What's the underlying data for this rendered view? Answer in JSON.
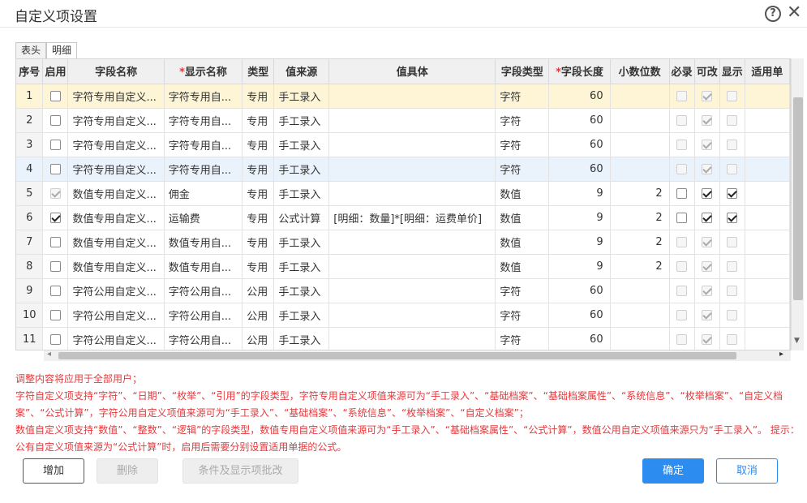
{
  "window": {
    "title": "自定义项设置"
  },
  "tabs": [
    {
      "label": "表头",
      "active": false
    },
    {
      "label": "明细",
      "active": true
    }
  ],
  "table": {
    "columns": [
      "序号",
      "启用",
      "字段名称",
      "显示名称",
      "类型",
      "值来源",
      "值具体",
      "字段类型",
      "字段长度",
      "小数位数",
      "必录",
      "可改",
      "显示",
      "适用单"
    ],
    "required_marks": {
      "显示名称": "*",
      "字段长度": "*"
    },
    "rows": [
      {
        "seq": "1",
        "enabled": false,
        "enabled_disabled": false,
        "field_name": "字符专用自定义...",
        "display_name": "字符专用自...",
        "type": "专用",
        "source": "手工录入",
        "value_detail": "",
        "field_type": "字符",
        "length": "60",
        "decimals": "",
        "required": false,
        "editable": true,
        "visible": false,
        "flags_disabled": true
      },
      {
        "seq": "2",
        "enabled": false,
        "enabled_disabled": false,
        "field_name": "字符专用自定义...",
        "display_name": "字符专用自...",
        "type": "专用",
        "source": "手工录入",
        "value_detail": "",
        "field_type": "字符",
        "length": "60",
        "decimals": "",
        "required": false,
        "editable": true,
        "visible": false,
        "flags_disabled": true
      },
      {
        "seq": "3",
        "enabled": false,
        "enabled_disabled": false,
        "field_name": "字符专用自定义...",
        "display_name": "字符专用自...",
        "type": "专用",
        "source": "手工录入",
        "value_detail": "",
        "field_type": "字符",
        "length": "60",
        "decimals": "",
        "required": false,
        "editable": true,
        "visible": false,
        "flags_disabled": true
      },
      {
        "seq": "4",
        "enabled": false,
        "enabled_disabled": false,
        "field_name": "字符专用自定义...",
        "display_name": "字符专用自...",
        "type": "专用",
        "source": "手工录入",
        "value_detail": "",
        "field_type": "字符",
        "length": "60",
        "decimals": "",
        "required": false,
        "editable": true,
        "visible": false,
        "flags_disabled": true
      },
      {
        "seq": "5",
        "enabled": true,
        "enabled_disabled": true,
        "field_name": "数值专用自定义...",
        "display_name": "佣金",
        "type": "专用",
        "source": "手工录入",
        "value_detail": "",
        "field_type": "数值",
        "length": "9",
        "decimals": "2",
        "required": false,
        "editable": true,
        "visible": true,
        "flags_disabled": false
      },
      {
        "seq": "6",
        "enabled": true,
        "enabled_disabled": false,
        "field_name": "数值专用自定义...",
        "display_name": "运输费",
        "type": "专用",
        "source": "公式计算",
        "value_detail": "[明细：数量]*[明细：运费单价]",
        "field_type": "数值",
        "length": "9",
        "decimals": "2",
        "required": false,
        "editable": true,
        "visible": true,
        "flags_disabled": false
      },
      {
        "seq": "7",
        "enabled": false,
        "enabled_disabled": false,
        "field_name": "数值专用自定义...",
        "display_name": "数值专用自...",
        "type": "专用",
        "source": "手工录入",
        "value_detail": "",
        "field_type": "数值",
        "length": "9",
        "decimals": "2",
        "required": false,
        "editable": true,
        "visible": false,
        "flags_disabled": true
      },
      {
        "seq": "8",
        "enabled": false,
        "enabled_disabled": false,
        "field_name": "数值专用自定义...",
        "display_name": "数值专用自...",
        "type": "专用",
        "source": "手工录入",
        "value_detail": "",
        "field_type": "数值",
        "length": "9",
        "decimals": "2",
        "required": false,
        "editable": true,
        "visible": false,
        "flags_disabled": true
      },
      {
        "seq": "9",
        "enabled": false,
        "enabled_disabled": false,
        "field_name": "字符公用自定义...",
        "display_name": "字符公用自...",
        "type": "公用",
        "source": "手工录入",
        "value_detail": "",
        "field_type": "字符",
        "length": "60",
        "decimals": "",
        "required": false,
        "editable": true,
        "visible": false,
        "flags_disabled": true
      },
      {
        "seq": "10",
        "enabled": false,
        "enabled_disabled": false,
        "field_name": "字符公用自定义...",
        "display_name": "字符公用自...",
        "type": "公用",
        "source": "手工录入",
        "value_detail": "",
        "field_type": "字符",
        "length": "60",
        "decimals": "",
        "required": false,
        "editable": true,
        "visible": false,
        "flags_disabled": true
      },
      {
        "seq": "11",
        "enabled": false,
        "enabled_disabled": false,
        "field_name": "字符公用自定义...",
        "display_name": "字符公用自...",
        "type": "公用",
        "source": "手工录入",
        "value_detail": "",
        "field_type": "字符",
        "length": "60",
        "decimals": "",
        "required": false,
        "editable": true,
        "visible": false,
        "flags_disabled": true
      }
    ]
  },
  "notes": [
    "调整内容将应用于全部用户；",
    "字符自定义项支持“字符”、“日期”、“枚举”、“引用”的字段类型，字符专用自定义项值来源可为“手工录入”、“基础档案”、“基础档案属性”、“系统信息”、“枚举档案”、“自定义档案”、“公式计算”，字符公用自定义项值来源可为“手工录入”、“基础档案”、“系统信息”、“枚举档案”、“自定义档案”；",
    "数值自定义项支持“数值”、“整数”、“逻辑”的字段类型，数值专用自定义项值来源可为“手工录入”、“基础档案属性”、“公式计算”，数值公用自定义项值来源只为“手工录入”。 提示：公有自定义项值来源为“公式计算”时，启用后需要分别设置适用单据的公式。"
  ],
  "buttons": {
    "add": "增加",
    "delete": "删除",
    "conditions": "条件及显示项批改",
    "ok": "确定",
    "cancel": "取消"
  },
  "colors": {
    "accent": "#2d8cf0",
    "note": "#e4393c",
    "selected_row": "#fdf5d6",
    "hover_row": "#eaf2fb"
  }
}
